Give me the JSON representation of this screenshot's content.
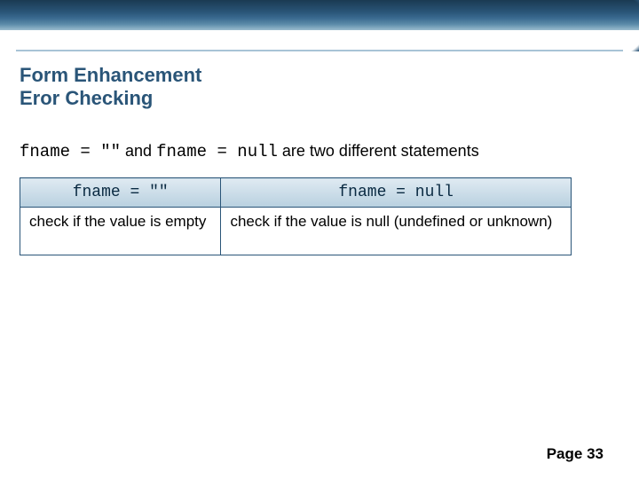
{
  "title": {
    "line1": "Form Enhancement",
    "line2": "Eror Checking"
  },
  "statement": {
    "code1": "fname = \"\"",
    "mid": " and ",
    "code2": "fname = null",
    "tail": " are two different statements"
  },
  "table": {
    "header": {
      "col1": "fname = \"\"",
      "col2": "fname = null"
    },
    "row1": {
      "col1": "check if the value is empty",
      "col2": "check if the value is null (undefined or unknown)"
    }
  },
  "footer": {
    "page_label": "Page",
    "page_num": "33"
  }
}
